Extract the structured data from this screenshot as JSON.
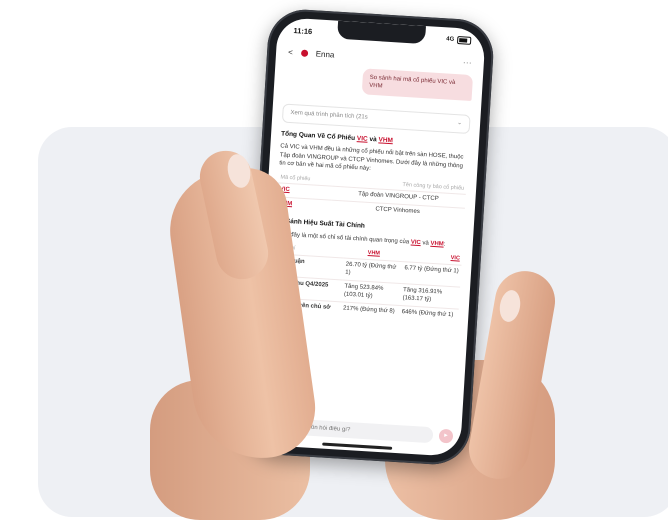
{
  "status": {
    "time": "11:16",
    "signal": "4G",
    "carrier_icons": "signal-wifi-battery"
  },
  "topbar": {
    "back": "<",
    "title": "Enna",
    "menu": "⋯"
  },
  "messages": {
    "user": "So sánh hai mã cổ phiếu VIC và VHM"
  },
  "thinking": {
    "label": "Xem quá trình phân tích (21s",
    "chevron": "⌄"
  },
  "section1": {
    "title_prefix": "Tổng Quan Về Cổ Phiếu ",
    "title_vic": "VIC",
    "title_and": " và ",
    "title_vhm": "VHM",
    "paragraph": "Cả VIC và VHM đều là những cổ phiếu nổi bật trên sàn HOSE, thuộc Tập đoàn VINGROUP và CTCP Vinhomes. Dưới đây là những thông tin cơ bản về hai mã cổ phiếu này:",
    "table_headers": [
      "Mã cổ phiếu",
      "Tên công ty bảo cổ phiếu"
    ],
    "rows": [
      [
        "VIC",
        "Tập đoàn VINGROUP - CTCP"
      ],
      [
        "VHM",
        "CTCP Vinhomes"
      ]
    ]
  },
  "section2": {
    "title": "So Sánh Hiệu Suất Tài Chính",
    "intro_text": "Dưới đây là một số chỉ số tài chính quan trọng của ",
    "intro_vic": "VIC",
    "intro_and": " và ",
    "intro_vhm": "VHM",
    "intro_end": ":",
    "table_headers": [
      "Tiêu chí",
      "VHM",
      "VIC"
    ],
    "rows": [
      [
        "Lợi nhuận",
        "26.70 tỷ (Đứng thứ 1)",
        "6.77 tỷ (Đứng thứ 1)"
      ],
      [
        "Doanh thu Q4/2025",
        "Tăng 523.84% (103.01 tỷ)",
        "Tăng 316.91% (163.17 tỷ)"
      ],
      [
        "Tỷ lệ nợ trên chủ sở hữu (D/E)",
        "217% (Đứng thứ 8)",
        "646% (Đứng thứ 1)"
      ]
    ]
  },
  "input": {
    "placeholder": "Bạn muốn hỏi điều gì?",
    "plus": "+",
    "send": "▸"
  },
  "colors": {
    "accent": "#c8102e",
    "bubble": "#f7dde0",
    "background_card": "#eef0f4"
  }
}
